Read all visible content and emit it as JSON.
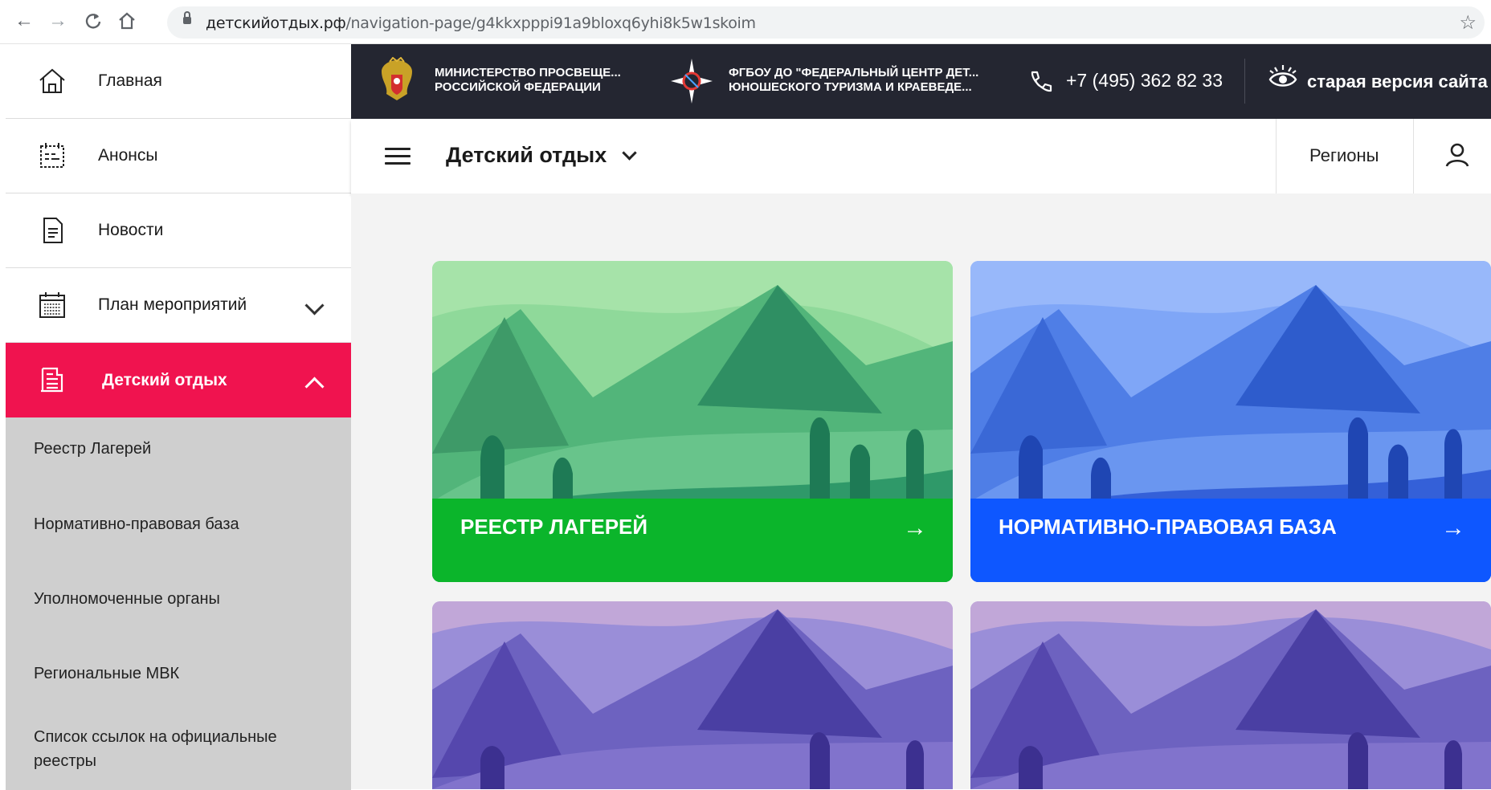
{
  "browser": {
    "url_domain": "детскийотдых.рф",
    "url_path": "/navigation-page/g4kkxpppi91a9bloxq6yhi8k5w1skoim",
    "icons": [
      "back-icon",
      "forward-icon",
      "reload-icon",
      "home-icon",
      "lock-icon",
      "star-icon"
    ]
  },
  "sidebar": {
    "items": [
      {
        "label": "Главная",
        "icon": "home-icon"
      },
      {
        "label": "Анонсы",
        "icon": "announce-icon"
      },
      {
        "label": "Новости",
        "icon": "news-icon"
      },
      {
        "label": "План мероприятий",
        "icon": "calendar-icon"
      },
      {
        "label": "Детский отдых",
        "icon": "building-icon"
      }
    ],
    "submenu": [
      "Реестр Лагерей",
      "Нормативно-правовая база",
      "Уполномоченные органы",
      "Региональные МВК",
      "Список ссылок на официальные реестры"
    ]
  },
  "topbar": {
    "org1_line1": "МИНИСТЕРСТВО ПРОСВЕЩЕ...",
    "org1_line2": "РОССИЙСКОЙ ФЕДЕРАЦИИ",
    "org2_line1": "ФГБОУ ДО \"ФЕДЕРАЛЬНЫЙ ЦЕНТР ДЕТ...",
    "org2_line2": "ЮНОШЕСКОГО ТУРИЗМА И КРАЕВЕДЕ...",
    "phone": "+7 (495) 362 82 33",
    "old_site": "старая версия сайта"
  },
  "header": {
    "section": "Детский отдых",
    "regions": "Регионы"
  },
  "cards": [
    {
      "title": "РЕЕСТР ЛАГЕРЕЙ",
      "color": "#0bb52b"
    },
    {
      "title": "НОРМАТИВНО-ПРАВОВАЯ БАЗА",
      "color": "#0e57ff"
    }
  ],
  "colors": {
    "accent": "#f0134f",
    "topbar": "#242631",
    "submenu_bg": "#cfcfcf"
  }
}
